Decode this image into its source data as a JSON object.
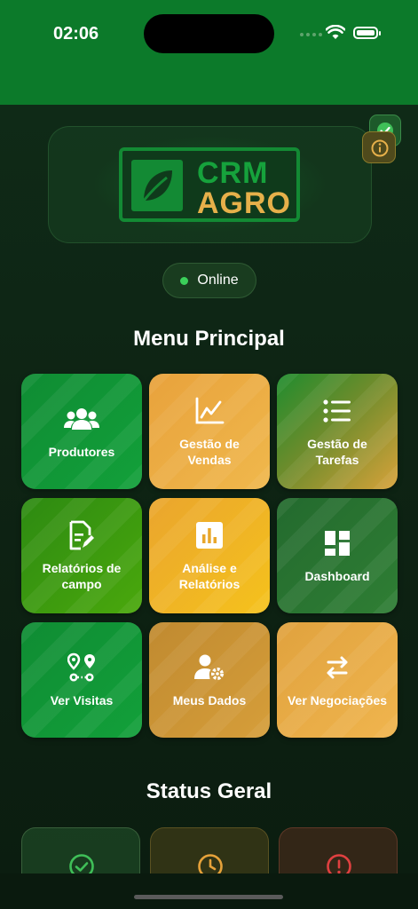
{
  "status": {
    "time": "02:06"
  },
  "logo": {
    "line1": "CRM",
    "line2": "AGRO"
  },
  "connection": {
    "label": "Online"
  },
  "menu": {
    "title": "Menu Principal",
    "tiles": [
      {
        "label": "Produtores",
        "icon": "users-icon"
      },
      {
        "label": "Gestão de Vendas",
        "icon": "chart-line-icon"
      },
      {
        "label": "Gestão de Tarefas",
        "icon": "list-icon"
      },
      {
        "label": "Relatórios de campo",
        "icon": "document-edit-icon"
      },
      {
        "label": "Análise e Relatórios",
        "icon": "bar-chart-icon"
      },
      {
        "label": "Dashboard",
        "icon": "dashboard-icon"
      },
      {
        "label": "Ver Visitas",
        "icon": "route-icon"
      },
      {
        "label": "Meus Dados",
        "icon": "user-gear-icon"
      },
      {
        "label": "Ver Negociações",
        "icon": "swap-arrows-icon"
      }
    ]
  },
  "status_section": {
    "title": "Status Geral",
    "cards": [
      {
        "icon": "check-circle-icon",
        "color": "#3fbf58"
      },
      {
        "icon": "clock-icon",
        "color": "#e6a23a"
      },
      {
        "icon": "error-circle-icon",
        "color": "#e04040"
      }
    ]
  },
  "colors": {
    "brand_green": "#0c7a2a",
    "accent_orange": "#e8a23c",
    "background": "#0e2414"
  }
}
